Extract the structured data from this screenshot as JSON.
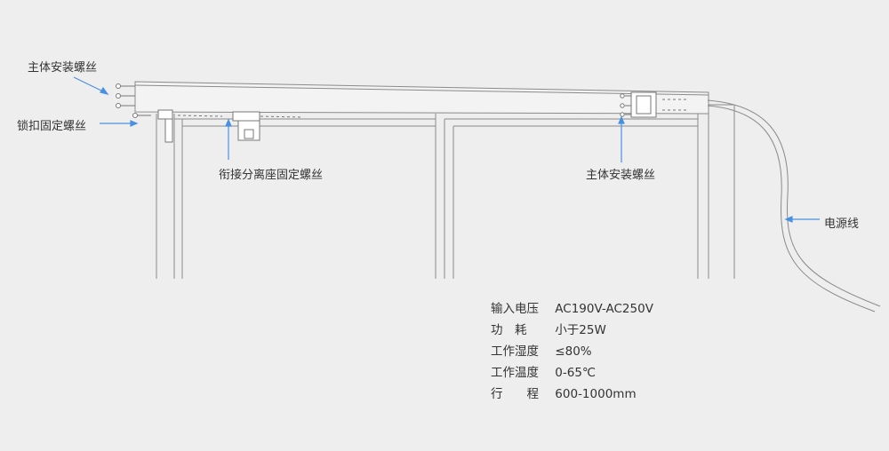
{
  "labels": {
    "main_screw_left": "主体安装螺丝",
    "lock_screw": "锁扣固定螺丝",
    "connector_screw": "衔接分离座固定螺丝",
    "main_screw_right": "主体安装螺丝",
    "power_cord": "电源线"
  },
  "specs": [
    {
      "key": "输入电压",
      "value": "AC190V-AC250V"
    },
    {
      "key": "功　耗",
      "value": "小于25W"
    },
    {
      "key": "工作湿度",
      "value": "≤80%"
    },
    {
      "key": "工作温度",
      "value": "0-65℃"
    },
    {
      "key": "行　　程",
      "value": "600-1000mm"
    }
  ],
  "colors": {
    "background": "#eeeeef",
    "line": "#8a8a8a",
    "pointer": "#4a90e2",
    "text": "#333333"
  }
}
